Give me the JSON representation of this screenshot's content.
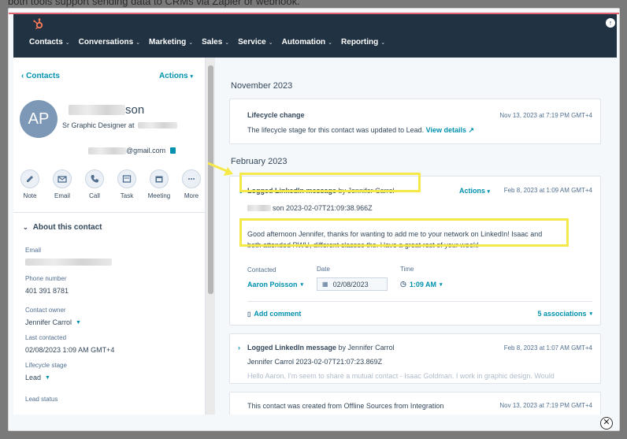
{
  "background_text": "both tools support sending data to CRMs via Zapier or webhook.",
  "nav": {
    "items": [
      "Contacts",
      "Conversations",
      "Marketing",
      "Sales",
      "Service",
      "Automation",
      "Reporting"
    ]
  },
  "sidebar": {
    "back_label": "Contacts",
    "actions_label": "Actions",
    "avatar_initials": "AP",
    "name_suffix": "son",
    "job_title": "Sr Graphic Designer at",
    "email_suffix": "@gmail.com",
    "quick_actions": [
      "Note",
      "Email",
      "Call",
      "Task",
      "Meeting",
      "More"
    ],
    "about_label": "About this contact",
    "fields": {
      "email_label": "Email",
      "phone_label": "Phone number",
      "phone_value": "401 391 8781",
      "owner_label": "Contact owner",
      "owner_value": "Jennifer Carrol",
      "last_contacted_label": "Last contacted",
      "last_contacted_value": "02/08/2023 1:09 AM GMT+4",
      "lifecycle_label": "Lifecycle stage",
      "lifecycle_value": "Lead",
      "lead_status_label": "Lead status"
    }
  },
  "timeline": {
    "month_nov": "November 2023",
    "month_feb": "February 2023",
    "lifecycle_card": {
      "title": "Lifecycle change",
      "date": "Nov 13, 2023 at 7:19 PM GMT+4",
      "text": "The lifecycle stage for this contact was updated to Lead.",
      "link": "View details"
    },
    "li_card_1": {
      "title_bold": "Logged LinkedIn message",
      "title_by": "by Jennifer Carrol",
      "actions": "Actions",
      "date": "Feb 8, 2023 at 1:09 AM GMT+4",
      "sub": "son 2023-02-07T21:09:38.966Z",
      "message_line1": "Good afternoon Jennifer, thanks for wanting to add me to your network on LinkedIn! Isaac and",
      "message_line2": "both attended RWU, different classes tho. Have a great rest of your week!",
      "contacted_label": "Contacted",
      "contacted_value": "Aaron Poisson",
      "date_label": "Date",
      "date_value": "02/08/2023",
      "time_label": "Time",
      "time_value": "1:09 AM",
      "add_comment": "Add comment",
      "associations": "5 associations"
    },
    "li_card_2": {
      "title_bold": "Logged LinkedIn message",
      "title_by": "by Jennifer Carrol",
      "date": "Feb 8, 2023 at 1:07 AM GMT+4",
      "sub": "Jennifer Carrol 2023-02-07T21:07:23.869Z",
      "preview": "Hello Aaron, I'm seem to share a mutual contact - Isaac Goldman. I work in graphic design. Would"
    },
    "created_card": {
      "text": "This contact was created from Offline Sources from Integration",
      "date": "Nov 13, 2023 at 7:19 PM GMT+4"
    }
  },
  "colors": {
    "topbar": "#213343",
    "link": "#0091ae",
    "highlight": "#f5e94a",
    "accent_line": "#e0636f"
  }
}
